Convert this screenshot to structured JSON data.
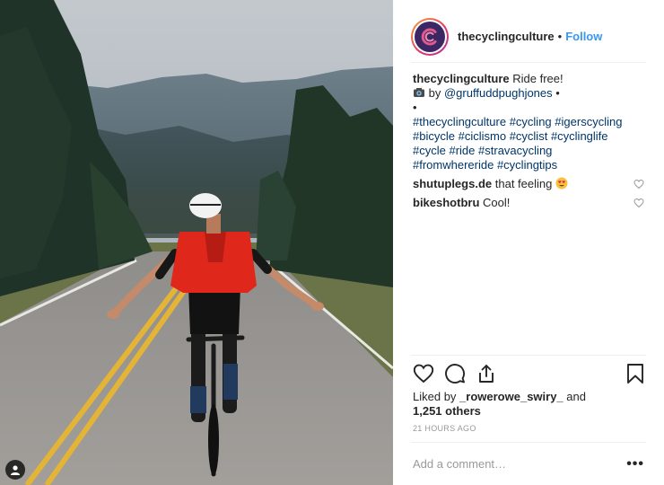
{
  "post": {
    "username": "thecyclingculture",
    "follow_label": "Follow",
    "header_separator": "•"
  },
  "caption": {
    "username": "thecyclingculture",
    "text": "Ride free!",
    "credit_prefix": "by",
    "credit_mention": "@gruffuddpughjones",
    "bullet": "•",
    "bullet2": "•",
    "hashtags": [
      [
        "#thecyclingculture",
        "#cycling",
        "#igerscycling"
      ],
      [
        "#bicycle",
        "#ciclismo",
        "#cyclist",
        "#cyclinglife"
      ],
      [
        "#cycle",
        "#ride",
        "#stravacycling"
      ],
      [
        "#fromwhereride",
        "#cyclingtips"
      ]
    ]
  },
  "comments": [
    {
      "username": "shutuplegs.de",
      "text": "that feeling",
      "emoji": "heart-eyes"
    },
    {
      "username": "bikeshotbru",
      "text": "Cool!"
    }
  ],
  "likes": {
    "prefix": "Liked by",
    "user": "_rowerowe_swiry_",
    "and": "and",
    "count": "1,251 others"
  },
  "timestamp": "21 HOURS AGO",
  "add_comment": {
    "placeholder": "Add a comment…",
    "more_label": "•••"
  },
  "colors": {
    "link": "#003569",
    "follow": "#3897f0",
    "text": "#262626",
    "muted": "#999999",
    "border": "#efefef",
    "jersey": "#e0271b"
  },
  "icons": [
    "camera-emoji-icon",
    "heart-icon",
    "comment-icon",
    "share-icon",
    "bookmark-icon",
    "user-tag-icon",
    "heart-eyes-emoji-icon"
  ]
}
